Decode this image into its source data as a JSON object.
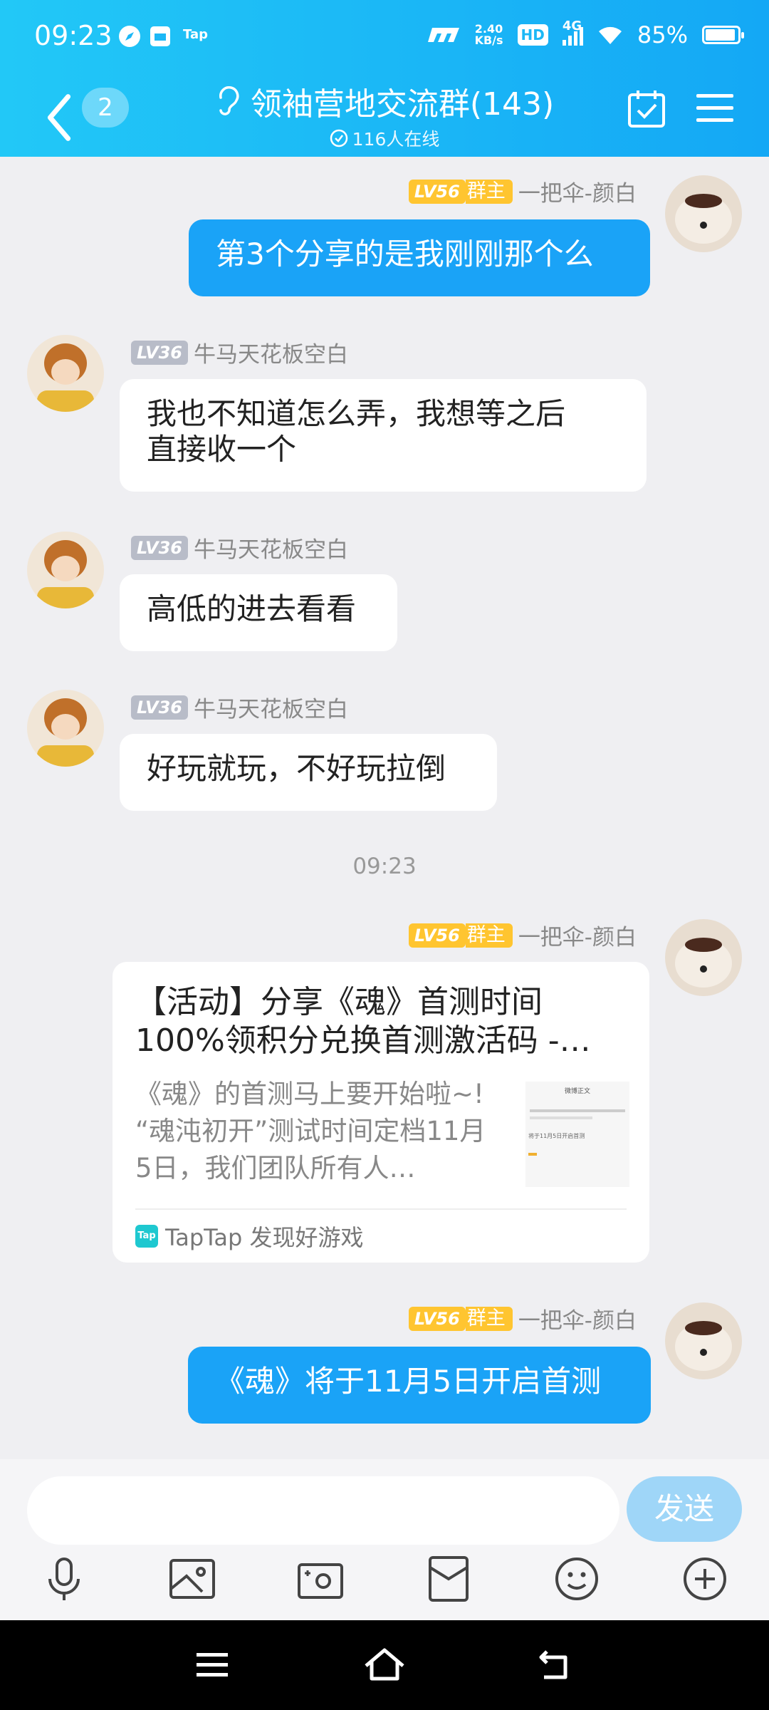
{
  "status_bar": {
    "time": "09:23",
    "tap_label": "Tap",
    "net_speed_value": "2.40",
    "net_speed_unit": "KB/s",
    "hd_label": "HD",
    "network": "4G",
    "battery": "85%",
    "battery_level": 0.85
  },
  "header": {
    "unread_count": "2",
    "group_title": "领袖营地交流群(143)",
    "online_text": "116人在线"
  },
  "messages": [
    {
      "level": "LV56",
      "role": "群主",
      "name": "一把伞-颜白",
      "text": "第3个分享的是我刚刚那个么"
    },
    {
      "level": "LV36",
      "name": "牛马天花板空白",
      "text_line1": "我也不知道怎么弄，我想等之后",
      "text_line2": "直接收一个"
    },
    {
      "level": "LV36",
      "name": "牛马天花板空白",
      "text": "高低的进去看看"
    },
    {
      "level": "LV36",
      "name": "牛马天花板空白",
      "text": "好玩就玩，不好玩拉倒"
    },
    {
      "level": "LV56",
      "role": "群主",
      "name": "一把伞-颜白"
    },
    {
      "level": "LV56",
      "role": "群主",
      "name": "一把伞-颜白",
      "text": "《魂》将于11月5日开启首测"
    }
  ],
  "timestamp": "09:23",
  "share_card": {
    "title_line1": "【活动】分享《魂》首测时间",
    "title_line2": "100%领积分兑换首测激活码 -…",
    "desc_line1": "《魂》的首测马上要开始啦~!",
    "desc_line2": "“魂沌初开”测试时间定档11月",
    "desc_line3": "5日，我们团队所有人…",
    "source_logo": "Tap",
    "source": "TapTap 发现好游戏",
    "thumb_heading": "微博正文",
    "thumb_text": "将于11月5日开启首测"
  },
  "input": {
    "placeholder": "",
    "send_label": "发送"
  },
  "colors": {
    "header_start": "#22c8f7",
    "header_end": "#14a8f5",
    "my_bubble": "#1aa3f7",
    "owner_badge": "#ffc530",
    "level_badge": "#b8bcc8"
  }
}
